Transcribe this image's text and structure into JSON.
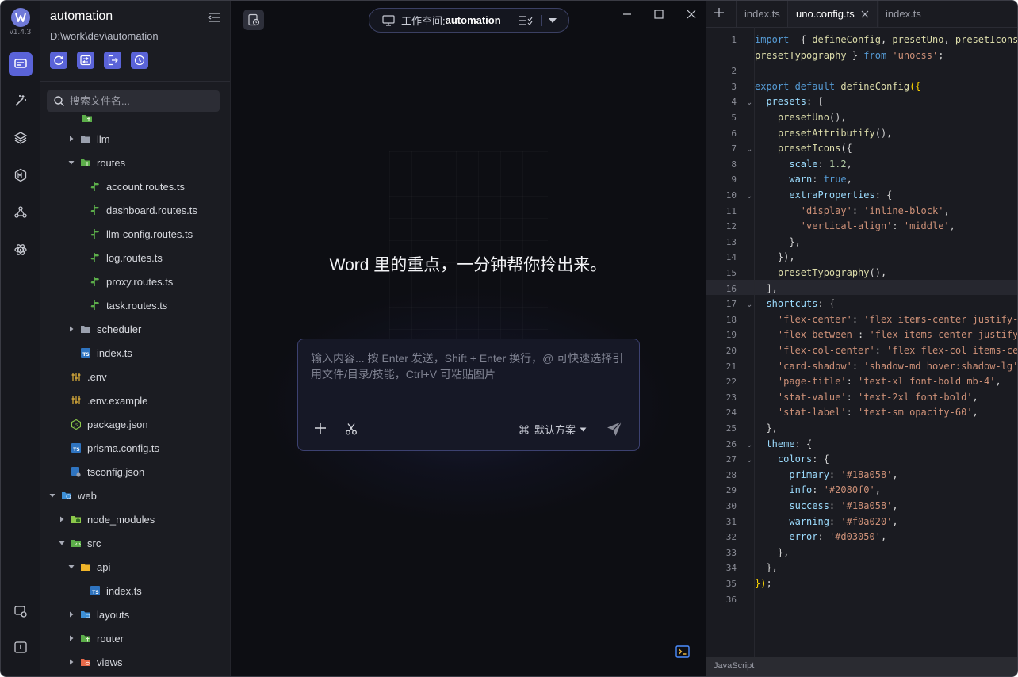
{
  "app": {
    "version": "v1.4.3"
  },
  "explorer": {
    "project_name": "automation",
    "project_path": "D:\\work\\dev\\automation",
    "search_placeholder": "搜索文件名..."
  },
  "tree": [
    {
      "label": "llm",
      "depth": 2,
      "type": "folder",
      "expanded": false,
      "icon": "folder-icon"
    },
    {
      "label": "routes",
      "depth": 2,
      "type": "folder",
      "expanded": true,
      "icon": "routes-folder-icon"
    },
    {
      "label": "account.routes.ts",
      "depth": 3,
      "type": "file",
      "icon": "route-file-icon"
    },
    {
      "label": "dashboard.routes.ts",
      "depth": 3,
      "type": "file",
      "icon": "route-file-icon"
    },
    {
      "label": "llm-config.routes.ts",
      "depth": 3,
      "type": "file",
      "icon": "route-file-icon"
    },
    {
      "label": "log.routes.ts",
      "depth": 3,
      "type": "file",
      "icon": "route-file-icon"
    },
    {
      "label": "proxy.routes.ts",
      "depth": 3,
      "type": "file",
      "icon": "route-file-icon"
    },
    {
      "label": "task.routes.ts",
      "depth": 3,
      "type": "file",
      "icon": "route-file-icon"
    },
    {
      "label": "scheduler",
      "depth": 2,
      "type": "folder",
      "expanded": false,
      "icon": "folder-icon"
    },
    {
      "label": "index.ts",
      "depth": 2,
      "type": "file",
      "icon": "typescript-icon"
    },
    {
      "label": ".env",
      "depth": 1,
      "type": "file",
      "icon": "env-icon"
    },
    {
      "label": ".env.example",
      "depth": 1,
      "type": "file",
      "icon": "env-icon"
    },
    {
      "label": "package.json",
      "depth": 1,
      "type": "file",
      "icon": "npm-icon"
    },
    {
      "label": "prisma.config.ts",
      "depth": 1,
      "type": "file",
      "icon": "typescript-icon"
    },
    {
      "label": "tsconfig.json",
      "depth": 1,
      "type": "file",
      "icon": "tsconfig-icon"
    },
    {
      "label": "web",
      "depth": 0,
      "type": "folder",
      "expanded": true,
      "icon": "web-folder-icon"
    },
    {
      "label": "node_modules",
      "depth": 1,
      "type": "folder",
      "expanded": false,
      "icon": "node-modules-folder-icon"
    },
    {
      "label": "src",
      "depth": 1,
      "type": "folder",
      "expanded": true,
      "icon": "src-folder-icon"
    },
    {
      "label": "api",
      "depth": 2,
      "type": "folder",
      "expanded": true,
      "icon": "api-folder-icon"
    },
    {
      "label": "index.ts",
      "depth": 3,
      "type": "file",
      "icon": "typescript-icon"
    },
    {
      "label": "layouts",
      "depth": 2,
      "type": "folder",
      "expanded": false,
      "icon": "layouts-folder-icon"
    },
    {
      "label": "router",
      "depth": 2,
      "type": "folder",
      "expanded": false,
      "icon": "router-folder-icon"
    },
    {
      "label": "views",
      "depth": 2,
      "type": "folder",
      "expanded": false,
      "icon": "views-folder-icon"
    }
  ],
  "workspace": {
    "label": "工作空间:",
    "value": "automation"
  },
  "main": {
    "heading": "Word 里的重点，一分钟帮你拎出来。"
  },
  "chat": {
    "placeholder": "输入内容... 按 Enter 发送，Shift + Enter 换行，@ 可快速选择引用文件/目录/技能，Ctrl+V 可粘贴图片",
    "scheme_label": "默认方案"
  },
  "editor": {
    "tabs": [
      {
        "label": "index.ts",
        "active": false
      },
      {
        "label": "uno.config.ts",
        "active": true
      },
      {
        "label": "index.ts",
        "active": false
      }
    ],
    "language": "JavaScript",
    "current_line": 16
  },
  "code_lines": [
    {
      "n": "1",
      "fold": false
    },
    {
      "n": "",
      "fold": false
    },
    {
      "n": "2",
      "fold": false
    },
    {
      "n": "3",
      "fold": false
    },
    {
      "n": "4",
      "fold": true
    },
    {
      "n": "5",
      "fold": false
    },
    {
      "n": "6",
      "fold": false
    },
    {
      "n": "7",
      "fold": true
    },
    {
      "n": "8",
      "fold": false
    },
    {
      "n": "9",
      "fold": false
    },
    {
      "n": "10",
      "fold": true
    },
    {
      "n": "11",
      "fold": false
    },
    {
      "n": "12",
      "fold": false
    },
    {
      "n": "13",
      "fold": false
    },
    {
      "n": "14",
      "fold": false
    },
    {
      "n": "15",
      "fold": false
    },
    {
      "n": "16",
      "fold": false
    },
    {
      "n": "17",
      "fold": true
    },
    {
      "n": "18",
      "fold": false
    },
    {
      "n": "19",
      "fold": false
    },
    {
      "n": "20",
      "fold": false
    },
    {
      "n": "21",
      "fold": false
    },
    {
      "n": "22",
      "fold": false
    },
    {
      "n": "23",
      "fold": false
    },
    {
      "n": "24",
      "fold": false
    },
    {
      "n": "25",
      "fold": false
    },
    {
      "n": "26",
      "fold": true
    },
    {
      "n": "27",
      "fold": true
    },
    {
      "n": "28",
      "fold": false
    },
    {
      "n": "29",
      "fold": false
    },
    {
      "n": "30",
      "fold": false
    },
    {
      "n": "31",
      "fold": false
    },
    {
      "n": "32",
      "fold": false
    },
    {
      "n": "33",
      "fold": false
    },
    {
      "n": "34",
      "fold": false
    },
    {
      "n": "35",
      "fold": false
    },
    {
      "n": "36",
      "fold": false
    }
  ],
  "code_tokens": [
    [
      [
        "k",
        "import"
      ],
      [
        "",
        "  { "
      ],
      [
        "f",
        "defineConfig"
      ],
      [
        "",
        ", "
      ],
      [
        "f",
        "presetUno"
      ],
      [
        "",
        ", "
      ],
      [
        "f",
        "presetIcons"
      ]
    ],
    [
      [
        "f",
        "presetTypography"
      ],
      [
        "",
        " } "
      ],
      [
        "k",
        "from"
      ],
      [
        "s",
        " 'unocss'"
      ],
      [
        "",
        ";"
      ]
    ],
    [],
    [
      [
        "k",
        "export"
      ],
      [
        "k",
        " default"
      ],
      [
        "f",
        " defineConfig"
      ],
      [
        "b",
        "({"
      ]
    ],
    [
      [
        "p",
        "  presets"
      ],
      [
        "",
        ": ["
      ]
    ],
    [
      [
        "f",
        "    presetUno"
      ],
      [
        "",
        "(),"
      ]
    ],
    [
      [
        "f",
        "    presetAttributify"
      ],
      [
        "",
        "(),"
      ]
    ],
    [
      [
        "f",
        "    presetIcons"
      ],
      [
        "",
        "({"
      ]
    ],
    [
      [
        "p",
        "      scale"
      ],
      [
        "",
        ": "
      ],
      [
        "n",
        "1.2"
      ],
      [
        "",
        ","
      ]
    ],
    [
      [
        "p",
        "      warn"
      ],
      [
        "",
        ": "
      ],
      [
        "k",
        "true"
      ],
      [
        "",
        ","
      ]
    ],
    [
      [
        "p",
        "      extraProperties"
      ],
      [
        "",
        ": {"
      ]
    ],
    [
      [
        "s",
        "        'display'"
      ],
      [
        "",
        ": "
      ],
      [
        "s",
        "'inline-block'"
      ],
      [
        "",
        ","
      ]
    ],
    [
      [
        "s",
        "        'vertical-align'"
      ],
      [
        "",
        ": "
      ],
      [
        "s",
        "'middle'"
      ],
      [
        "",
        ","
      ]
    ],
    [
      [
        "",
        "      },"
      ]
    ],
    [
      [
        "",
        "    }),"
      ]
    ],
    [
      [
        "f",
        "    presetTypography"
      ],
      [
        "",
        "(),"
      ]
    ],
    [
      [
        "",
        "  ],"
      ]
    ],
    [
      [
        "p",
        "  shortcuts"
      ],
      [
        "",
        ": {"
      ]
    ],
    [
      [
        "s",
        "    'flex-center'"
      ],
      [
        "",
        ": "
      ],
      [
        "s",
        "'flex items-center justify-center'"
      ]
    ],
    [
      [
        "s",
        "    'flex-between'"
      ],
      [
        "",
        ": "
      ],
      [
        "s",
        "'flex items-center justify-between'"
      ]
    ],
    [
      [
        "s",
        "    'flex-col-center'"
      ],
      [
        "",
        ": "
      ],
      [
        "s",
        "'flex flex-col items-center'"
      ]
    ],
    [
      [
        "s",
        "    'card-shadow'"
      ],
      [
        "",
        ": "
      ],
      [
        "s",
        "'shadow-md hover:shadow-lg'"
      ]
    ],
    [
      [
        "s",
        "    'page-title'"
      ],
      [
        "",
        ": "
      ],
      [
        "s",
        "'text-xl font-bold mb-4'"
      ],
      [
        "",
        ","
      ]
    ],
    [
      [
        "s",
        "    'stat-value'"
      ],
      [
        "",
        ": "
      ],
      [
        "s",
        "'text-2xl font-bold'"
      ],
      [
        "",
        ","
      ]
    ],
    [
      [
        "s",
        "    'stat-label'"
      ],
      [
        "",
        ": "
      ],
      [
        "s",
        "'text-sm opacity-60'"
      ],
      [
        "",
        ","
      ]
    ],
    [
      [
        "",
        "  },"
      ]
    ],
    [
      [
        "p",
        "  theme"
      ],
      [
        "",
        ": {"
      ]
    ],
    [
      [
        "p",
        "    colors"
      ],
      [
        "",
        ": {"
      ]
    ],
    [
      [
        "p",
        "      primary"
      ],
      [
        "",
        ": "
      ],
      [
        "s",
        "'#18a058'"
      ],
      [
        "",
        ","
      ]
    ],
    [
      [
        "p",
        "      info"
      ],
      [
        "",
        ": "
      ],
      [
        "s",
        "'#2080f0'"
      ],
      [
        "",
        ","
      ]
    ],
    [
      [
        "p",
        "      success"
      ],
      [
        "",
        ": "
      ],
      [
        "s",
        "'#18a058'"
      ],
      [
        "",
        ","
      ]
    ],
    [
      [
        "p",
        "      warning"
      ],
      [
        "",
        ": "
      ],
      [
        "s",
        "'#f0a020'"
      ],
      [
        "",
        ","
      ]
    ],
    [
      [
        "p",
        "      error"
      ],
      [
        "",
        ": "
      ],
      [
        "s",
        "'#d03050'"
      ],
      [
        "",
        ","
      ]
    ],
    [
      [
        "",
        "    },"
      ]
    ],
    [
      [
        "",
        "  },"
      ]
    ],
    [
      [
        "b",
        "})"
      ],
      [
        "",
        ";"
      ]
    ],
    []
  ],
  "colors": {
    "accent": "#5a63d8",
    "panel": "#1b1c22",
    "center_bg": "#0d0e13",
    "editor_bg": "#1a1b21"
  }
}
